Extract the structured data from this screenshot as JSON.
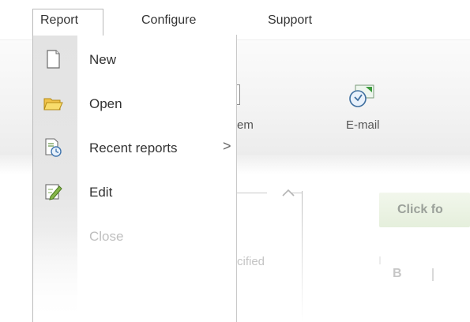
{
  "menubar": {
    "report": "Report",
    "configure": "Configure",
    "support": "Support"
  },
  "ribbon": {
    "item_label": "em",
    "email_label": "E-mail"
  },
  "background": {
    "specified_text": "cified",
    "click_button": "Click fo",
    "bold_letter": "B",
    "panel_caret": "^"
  },
  "dropdown": {
    "items": [
      {
        "label": "New",
        "icon": "new-document-icon",
        "enabled": true
      },
      {
        "label": "Open",
        "icon": "open-folder-icon",
        "enabled": true
      },
      {
        "label": "Recent reports",
        "icon": "recent-reports-icon",
        "enabled": true,
        "submenu_arrow": ">"
      },
      {
        "label": "Edit",
        "icon": "edit-icon",
        "enabled": true
      },
      {
        "label": "Close",
        "icon": null,
        "enabled": false
      }
    ]
  },
  "colors": {
    "gutter": "#e3e3e3",
    "menu_border": "#bcbcbc",
    "disabled_text": "#bcbcbc",
    "button_green": "#e5efdc"
  }
}
